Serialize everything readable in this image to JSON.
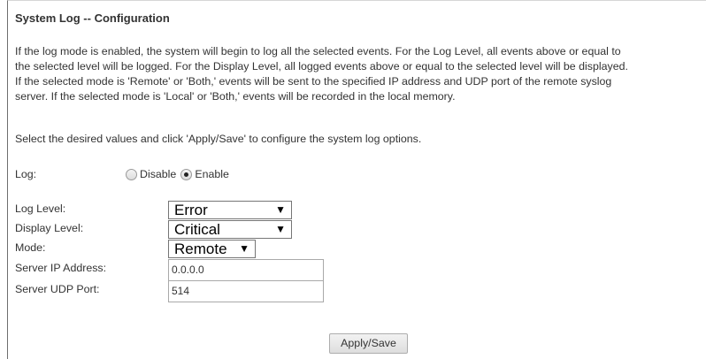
{
  "page": {
    "title": "System Log -- Configuration",
    "description": [
      "If the log mode is enabled, the system will begin to log all the selected events. For the Log Level, all events above or equal to",
      "the selected level will be logged. For the Display Level, all logged events above or equal to the selected level will be displayed.",
      "If the selected mode is 'Remote' or 'Both,' events will be sent to the specified IP address and UDP port of the remote syslog",
      "server. If the selected mode is 'Local' or 'Both,' events will be recorded in the local memory."
    ],
    "instructions": "Select the desired values and click 'Apply/Save' to configure the system log options."
  },
  "form": {
    "log": {
      "label": "Log:",
      "options": [
        {
          "label": "Disable",
          "checked": false
        },
        {
          "label": "Enable",
          "checked": true
        }
      ]
    },
    "log_level": {
      "label": "Log Level:",
      "value": "Error"
    },
    "display_level": {
      "label": "Display Level:",
      "value": "Critical"
    },
    "mode": {
      "label": "Mode:",
      "value": "Remote"
    },
    "server_ip": {
      "label": "Server IP Address:",
      "value": "0.0.0.0"
    },
    "server_port": {
      "label": "Server UDP Port:",
      "value": "514"
    },
    "dropdown_arrow": "▼",
    "apply_label": "Apply/Save"
  }
}
